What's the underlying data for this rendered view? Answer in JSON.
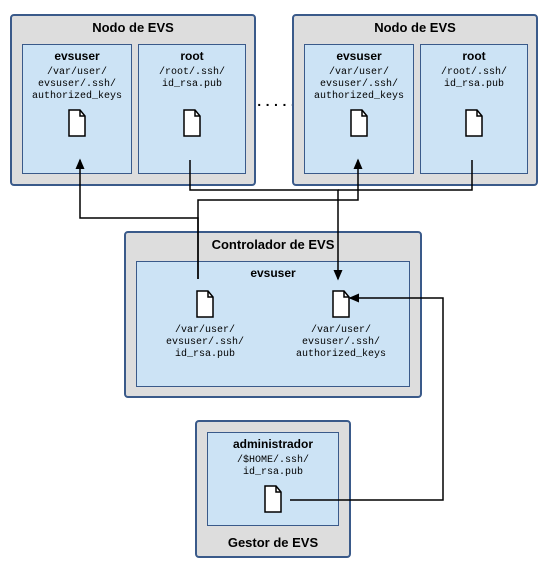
{
  "nodes": {
    "left": {
      "title": "Nodo de EVS",
      "evsuser": {
        "label": "evsuser",
        "path": "/var/user/\nevsuser/.ssh/\nauthorized_keys"
      },
      "root": {
        "label": "root",
        "path": "/root/.ssh/\nid_rsa.pub"
      }
    },
    "right": {
      "title": "Nodo de EVS",
      "evsuser": {
        "label": "evsuser",
        "path": "/var/user/\nevsuser/.ssh/\nauthorized_keys"
      },
      "root": {
        "label": "root",
        "path": "/root/.ssh/\nid_rsa.pub"
      }
    }
  },
  "controller": {
    "title": "Controlador de EVS",
    "user": "evsuser",
    "pub": "/var/user/\nevsuser/.ssh/\nid_rsa.pub",
    "auth": "/var/user/\nevsuser/.ssh/\nauthorized_keys"
  },
  "manager": {
    "title": "Gestor de EVS",
    "user": "administrador",
    "path": "/$HOME/.ssh/\nid_rsa.pub"
  },
  "dots": "....."
}
